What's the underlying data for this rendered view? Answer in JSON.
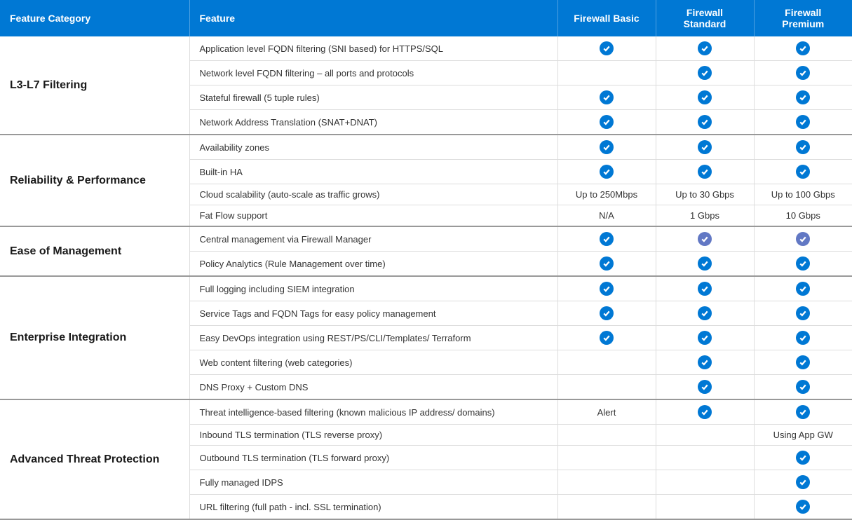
{
  "headers": {
    "category": "Feature Category",
    "feature": "Feature",
    "basic": "Firewall Basic",
    "standard": "Firewall Standard",
    "premium": "Firewall Premium"
  },
  "groups": [
    {
      "category": "L3-L7 Filtering",
      "rows": [
        {
          "feature": "Application level FQDN filtering (SNI based) for HTTPS/SQL",
          "basic": {
            "type": "check"
          },
          "standard": {
            "type": "check"
          },
          "premium": {
            "type": "check"
          }
        },
        {
          "feature": "Network level FQDN filtering – all ports and protocols",
          "basic": {
            "type": "empty"
          },
          "standard": {
            "type": "check"
          },
          "premium": {
            "type": "check"
          }
        },
        {
          "feature": "Stateful firewall (5 tuple rules)",
          "basic": {
            "type": "check"
          },
          "standard": {
            "type": "check"
          },
          "premium": {
            "type": "check"
          }
        },
        {
          "feature": "Network Address Translation (SNAT+DNAT)",
          "basic": {
            "type": "check"
          },
          "standard": {
            "type": "check"
          },
          "premium": {
            "type": "check"
          }
        }
      ]
    },
    {
      "category": "Reliability & Performance",
      "rows": [
        {
          "feature": "Availability zones",
          "basic": {
            "type": "check"
          },
          "standard": {
            "type": "check"
          },
          "premium": {
            "type": "check"
          }
        },
        {
          "feature": "Built-in  HA",
          "basic": {
            "type": "check"
          },
          "standard": {
            "type": "check"
          },
          "premium": {
            "type": "check"
          }
        },
        {
          "feature": "Cloud scalability (auto-scale as traffic grows)",
          "basic": {
            "type": "text",
            "value": "Up to 250Mbps"
          },
          "standard": {
            "type": "text",
            "value": "Up to 30 Gbps"
          },
          "premium": {
            "type": "text",
            "value": "Up to 100 Gbps"
          }
        },
        {
          "feature": " Fat Flow support",
          "basic": {
            "type": "text",
            "value": "N/A"
          },
          "standard": {
            "type": "text",
            "value": "1 Gbps"
          },
          "premium": {
            "type": "text",
            "value": "10 Gbps"
          }
        }
      ]
    },
    {
      "category": "Ease of Management",
      "rows": [
        {
          "feature": "Central management via Firewall Manager",
          "basic": {
            "type": "check"
          },
          "standard": {
            "type": "check-alt"
          },
          "premium": {
            "type": "check-alt"
          }
        },
        {
          "feature": "Policy Analytics (Rule Management over time)",
          "basic": {
            "type": "check"
          },
          "standard": {
            "type": "check"
          },
          "premium": {
            "type": "check"
          }
        }
      ]
    },
    {
      "category": "Enterprise Integration",
      "rows": [
        {
          "feature": "Full logging including SIEM integration",
          "basic": {
            "type": "check"
          },
          "standard": {
            "type": "check"
          },
          "premium": {
            "type": "check"
          }
        },
        {
          "feature": "Service Tags and FQDN Tags for easy policy management",
          "basic": {
            "type": "check"
          },
          "standard": {
            "type": "check"
          },
          "premium": {
            "type": "check"
          }
        },
        {
          "feature": "Easy DevOps integration using REST/PS/CLI/Templates/ Terraform",
          "basic": {
            "type": "check"
          },
          "standard": {
            "type": "check"
          },
          "premium": {
            "type": "check"
          }
        },
        {
          "feature": "Web content filtering (web categories)",
          "basic": {
            "type": "empty"
          },
          "standard": {
            "type": "check"
          },
          "premium": {
            "type": "check"
          }
        },
        {
          "feature": "DNS Proxy + Custom DNS",
          "basic": {
            "type": "empty"
          },
          "standard": {
            "type": "check"
          },
          "premium": {
            "type": "check"
          }
        }
      ]
    },
    {
      "category": "Advanced Threat Protection",
      "rows": [
        {
          "feature": "Threat intelligence-based filtering (known malicious IP address/ domains)",
          "basic": {
            "type": "text",
            "value": "Alert"
          },
          "standard": {
            "type": "check"
          },
          "premium": {
            "type": "check"
          }
        },
        {
          "feature": "Inbound TLS termination (TLS reverse proxy)",
          "basic": {
            "type": "empty"
          },
          "standard": {
            "type": "empty"
          },
          "premium": {
            "type": "text",
            "value": "Using App GW"
          }
        },
        {
          "feature": "Outbound TLS termination (TLS forward proxy)",
          "basic": {
            "type": "empty"
          },
          "standard": {
            "type": "empty"
          },
          "premium": {
            "type": "check"
          }
        },
        {
          "feature": "Fully managed IDPS",
          "basic": {
            "type": "empty"
          },
          "standard": {
            "type": "empty"
          },
          "premium": {
            "type": "check"
          }
        },
        {
          "feature": "URL filtering (full path - incl. SSL termination)",
          "basic": {
            "type": "empty"
          },
          "standard": {
            "type": "empty"
          },
          "premium": {
            "type": "check"
          }
        }
      ]
    }
  ]
}
